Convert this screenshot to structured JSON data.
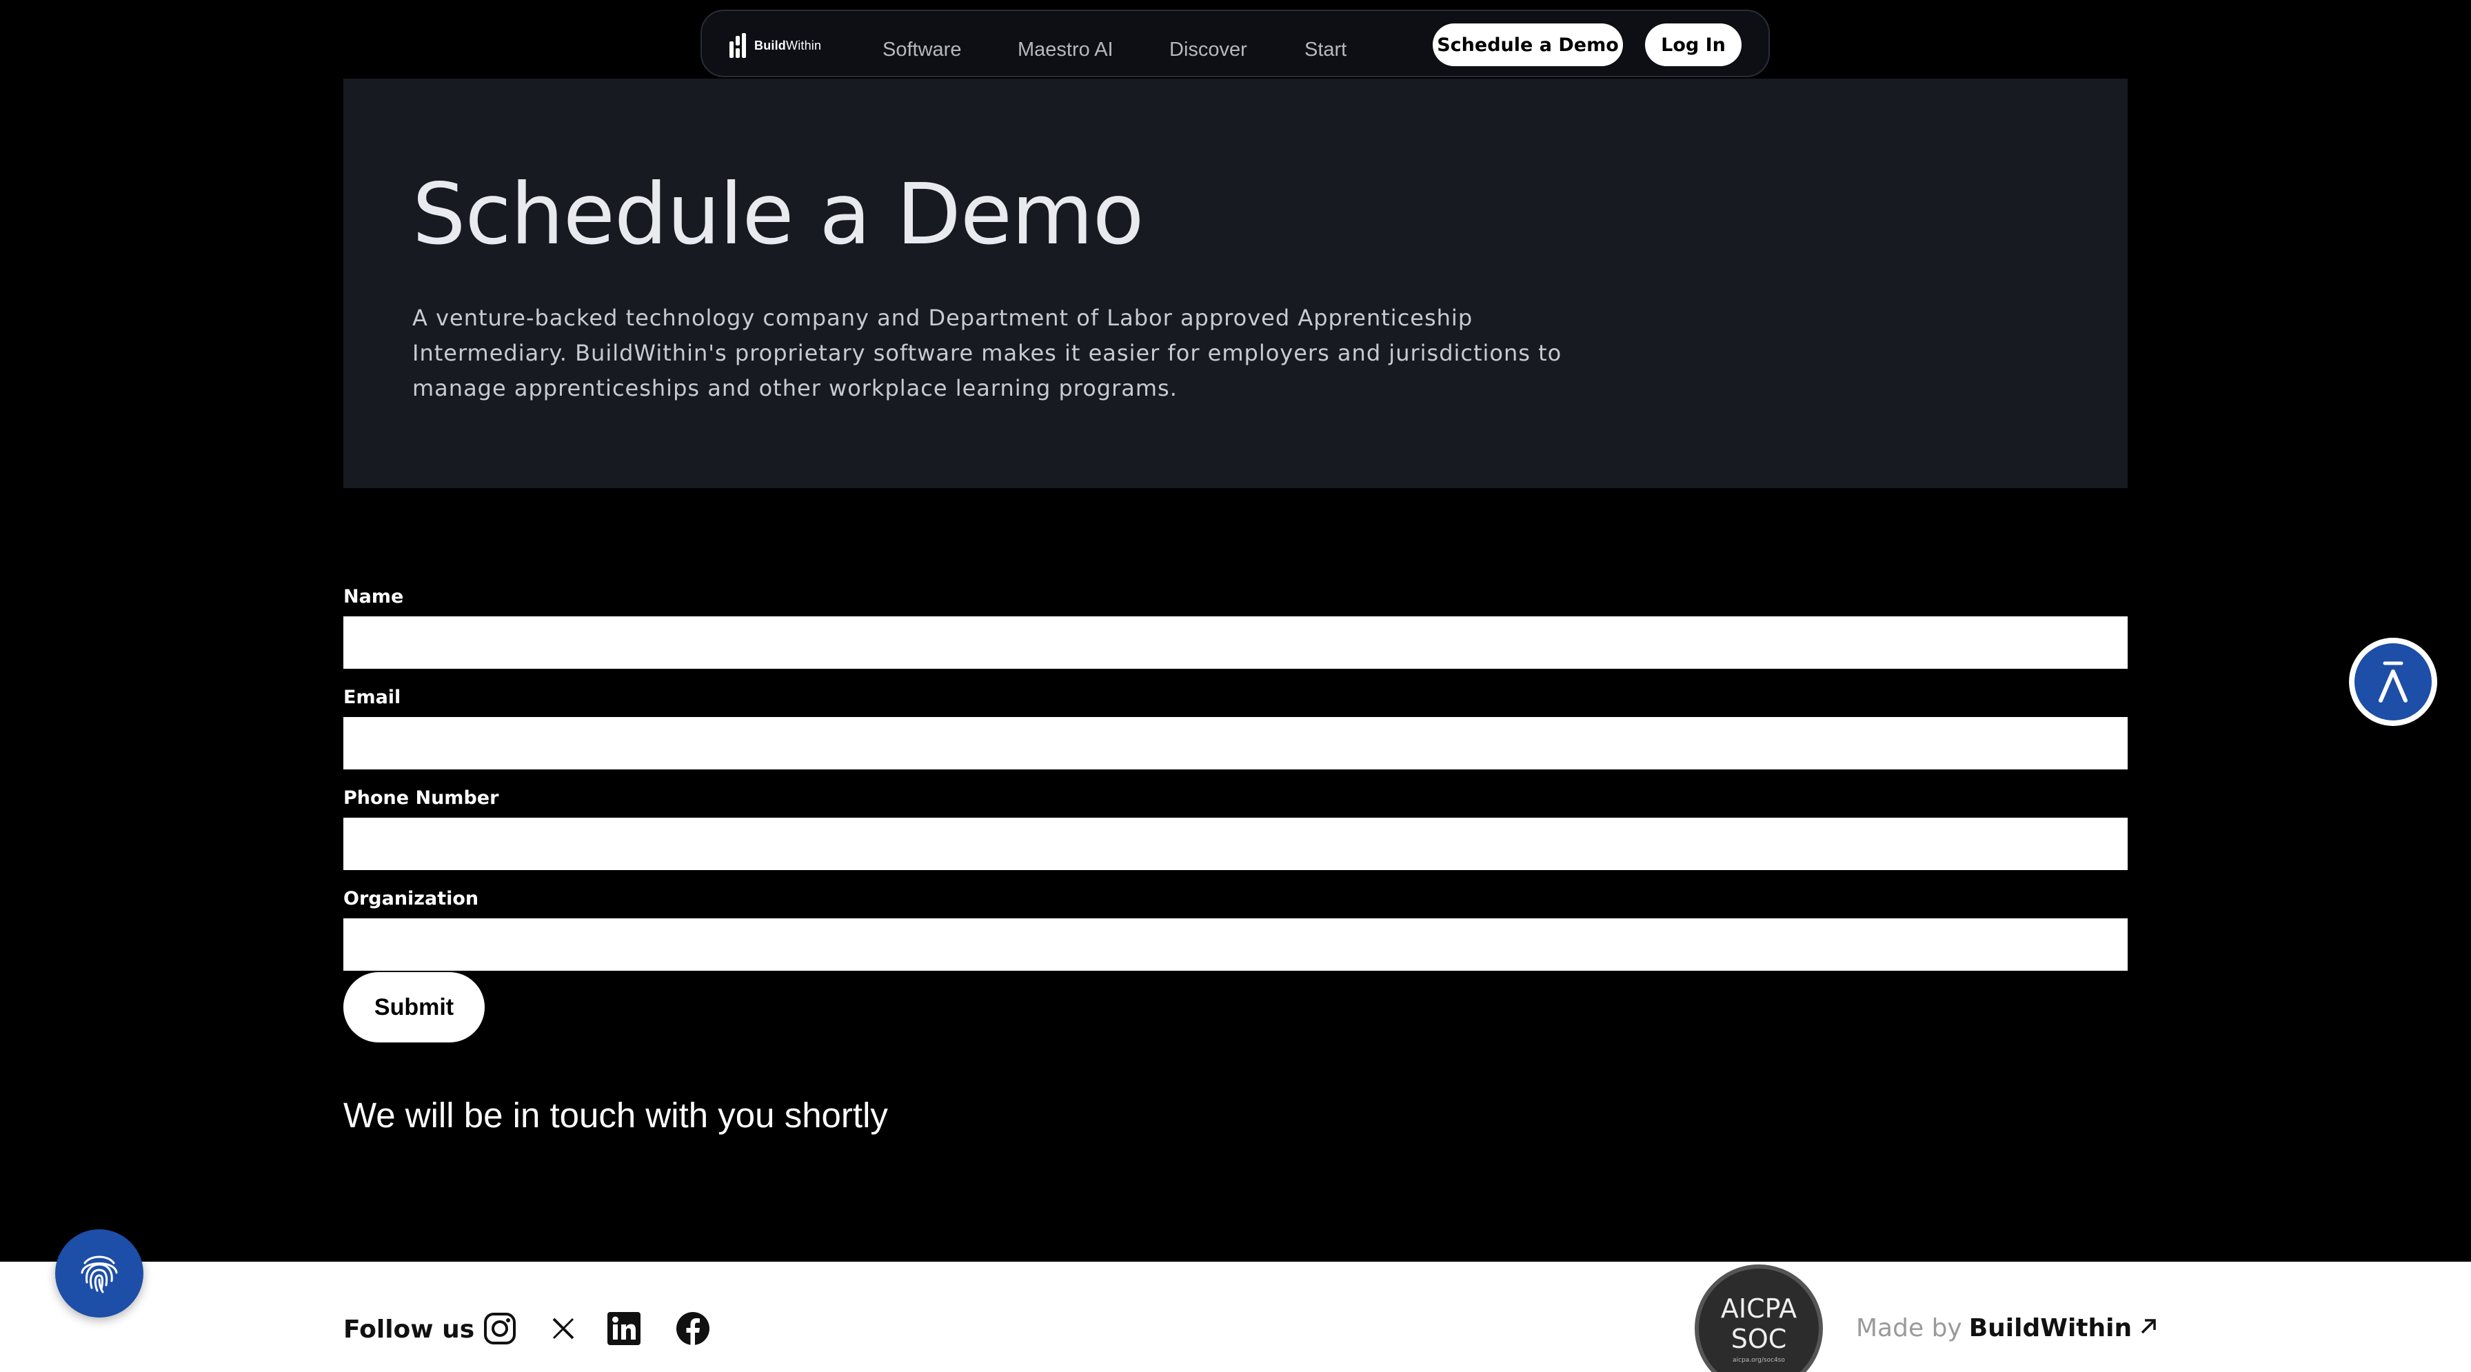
{
  "nav": {
    "logo_text_bold": "Build",
    "logo_text_light": "Within",
    "links": [
      "Software",
      "Maestro AI",
      "Discover",
      "Start"
    ],
    "schedule_label": "Schedule a Demo",
    "login_label": "Log In"
  },
  "hero": {
    "title": "Schedule a Demo",
    "description": "A venture-backed technology company and Department of Labor approved Apprenticeship Intermediary. BuildWithin's proprietary software makes it easier for employers and jurisdictions to manage apprenticeships and other workplace learning programs."
  },
  "form": {
    "fields": [
      {
        "label": "Name",
        "value": ""
      },
      {
        "label": "Email",
        "value": ""
      },
      {
        "label": "Phone Number",
        "value": ""
      },
      {
        "label": "Organization",
        "value": ""
      }
    ],
    "submit_label": "Submit",
    "confirmation": "We will be in touch with you shortly"
  },
  "widgets": {
    "accessibility_icon": "accessibility-icon",
    "fingerprint_icon": "fingerprint-icon"
  },
  "footer": {
    "follow_label": "Follow us",
    "social_icons": [
      "instagram-icon",
      "x-icon",
      "linkedin-icon",
      "facebook-icon"
    ],
    "badge_line1": "AICPA",
    "badge_line2": "SOC",
    "badge_small": "aicpa.org/soc4so",
    "made_by_prefix": "Made by",
    "made_by_brand": "BuildWithin"
  },
  "colors": {
    "background": "#000000",
    "hero_bg": "#181a22",
    "accent_blue": "#1d4ea8",
    "footer_bg": "#ffffff"
  }
}
